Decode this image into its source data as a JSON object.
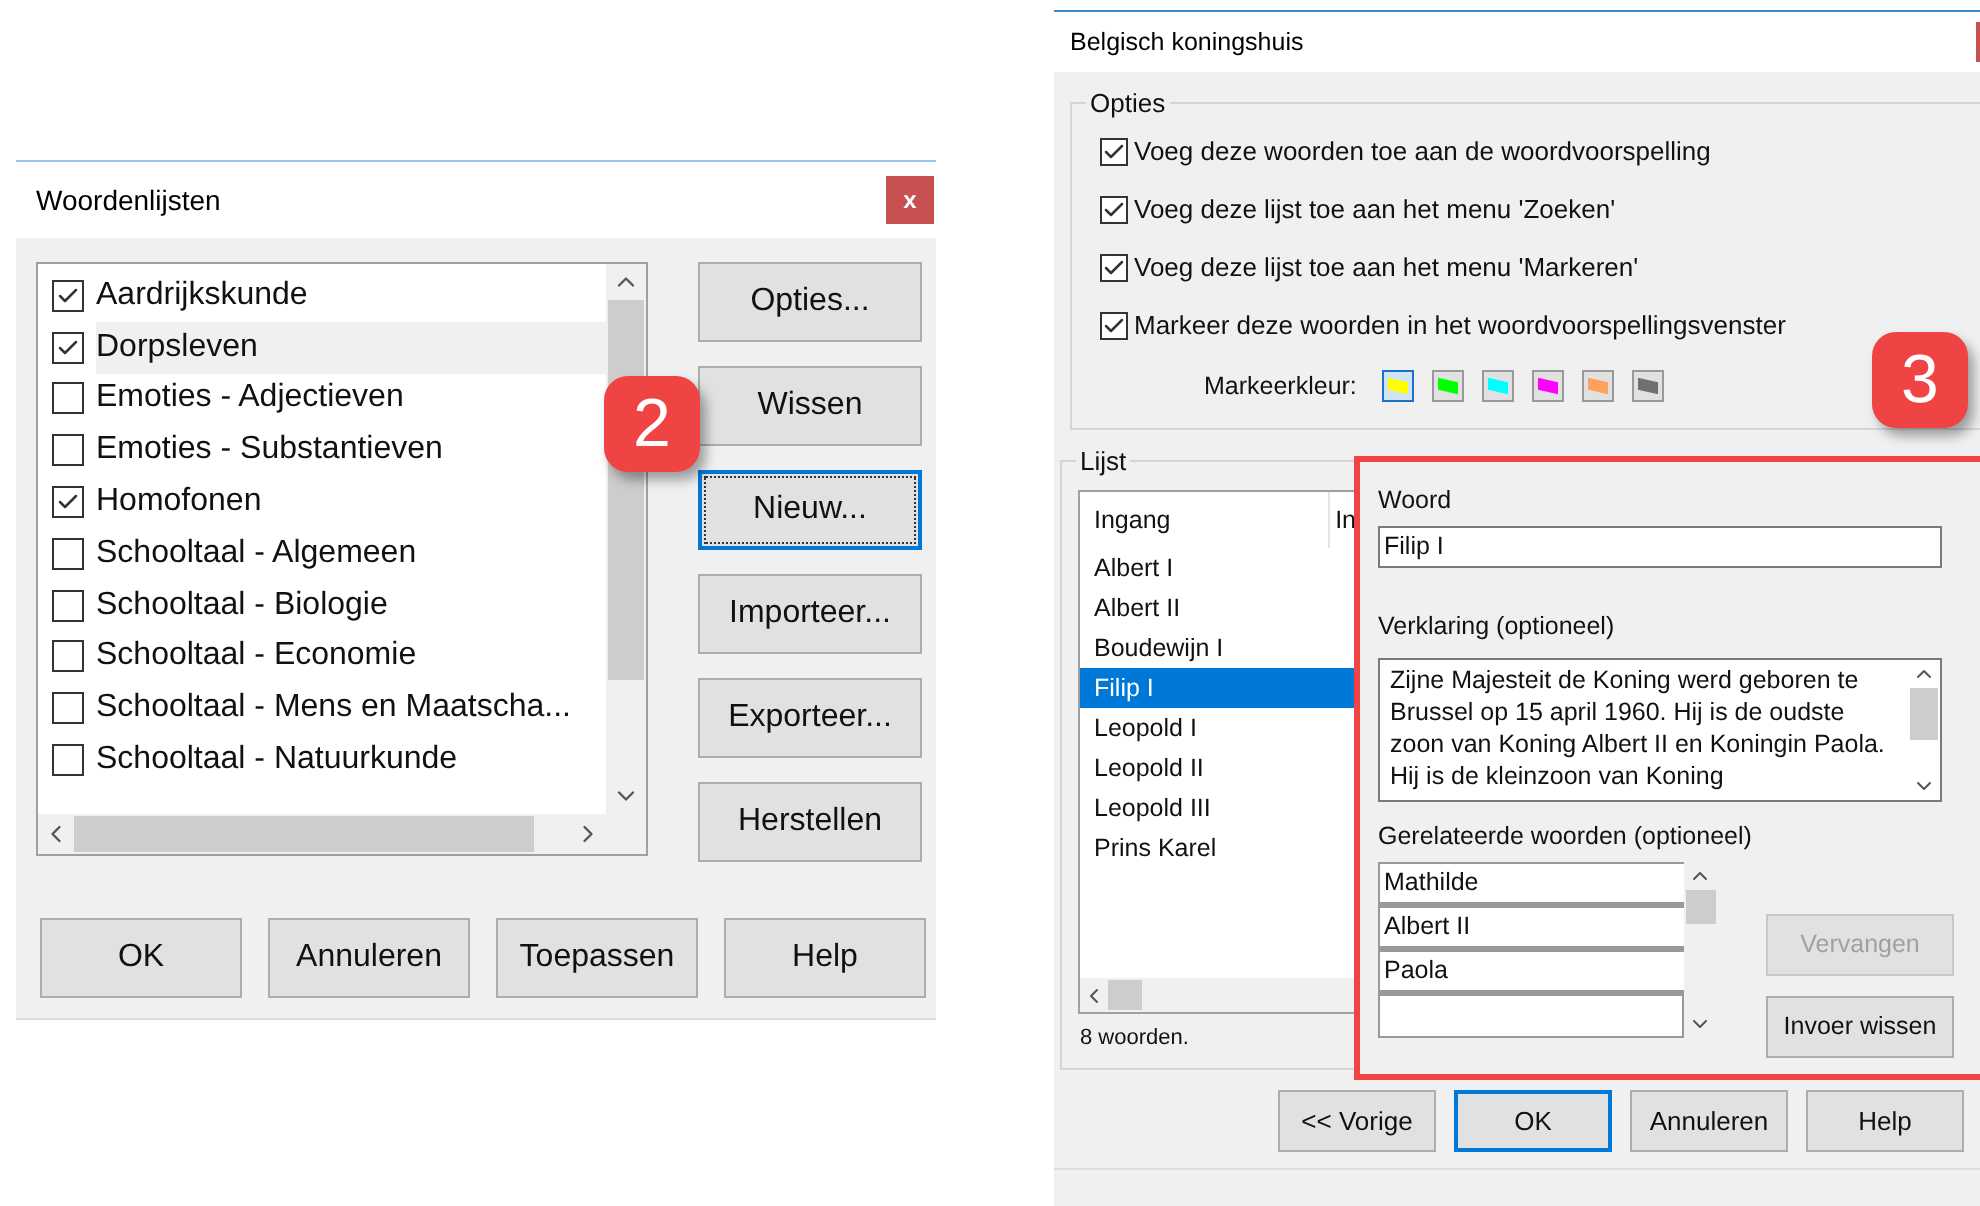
{
  "left_dialog": {
    "title": "Woordenlijsten",
    "close": "x",
    "lists": [
      {
        "label": "Aardrijkskunde",
        "checked": true,
        "selected": false
      },
      {
        "label": "Dorpsleven",
        "checked": true,
        "selected": true
      },
      {
        "label": "Emoties - Adjectieven",
        "checked": false,
        "selected": false
      },
      {
        "label": "Emoties - Substantieven",
        "checked": false,
        "selected": false
      },
      {
        "label": "Homofonen",
        "checked": true,
        "selected": false
      },
      {
        "label": "Schooltaal - Algemeen",
        "checked": false,
        "selected": false
      },
      {
        "label": "Schooltaal - Biologie",
        "checked": false,
        "selected": false
      },
      {
        "label": "Schooltaal - Economie",
        "checked": false,
        "selected": false
      },
      {
        "label": "Schooltaal - Mens en Maatscha...",
        "checked": false,
        "selected": false
      },
      {
        "label": "Schooltaal - Natuurkunde",
        "checked": false,
        "selected": false
      }
    ],
    "side_buttons": [
      {
        "label": "Opties...",
        "focused": false
      },
      {
        "label": "Wissen",
        "focused": false
      },
      {
        "label": "Nieuw...",
        "focused": true
      },
      {
        "label": "Importeer...",
        "focused": false
      },
      {
        "label": "Exporteer...",
        "focused": false
      },
      {
        "label": "Herstellen",
        "focused": false
      }
    ],
    "buttons": [
      "OK",
      "Annuleren",
      "Toepassen",
      "Help"
    ],
    "badge": "2"
  },
  "right_dialog": {
    "title": "Belgisch koningshuis",
    "options_group": {
      "title": "Opties",
      "options": [
        {
          "label": "Voeg deze woorden toe aan de woordvoorspelling",
          "checked": true
        },
        {
          "label": "Voeg deze lijst toe aan het menu 'Zoeken'",
          "checked": true
        },
        {
          "label": "Voeg deze lijst toe aan het menu 'Markeren'",
          "checked": true
        },
        {
          "label": "Markeer deze woorden in het woordvoorspellingsvenster",
          "checked": true
        }
      ],
      "color_label": "Markeerkleur:",
      "colors": [
        {
          "color": "#ffff00",
          "selected": true
        },
        {
          "color": "#00ff00",
          "selected": false
        },
        {
          "color": "#00ffff",
          "selected": false
        },
        {
          "color": "#ff00ff",
          "selected": false
        },
        {
          "color": "#ffa060",
          "selected": false
        },
        {
          "color": "#707070",
          "selected": false
        }
      ]
    },
    "list_group": {
      "title": "Lijst",
      "columns": [
        "Ingang",
        "In"
      ],
      "entries": [
        {
          "label": "Albert I",
          "selected": false
        },
        {
          "label": "Albert II",
          "selected": false
        },
        {
          "label": "Boudewijn I",
          "selected": false
        },
        {
          "label": "Filip I",
          "selected": true
        },
        {
          "label": "Leopold I",
          "selected": false
        },
        {
          "label": "Leopold II",
          "selected": false
        },
        {
          "label": "Leopold III",
          "selected": false
        },
        {
          "label": "Prins Karel",
          "selected": false
        }
      ],
      "count": "8 woorden."
    },
    "editor": {
      "word_label": "Woord",
      "word": "Filip I",
      "explanation_label": "Verklaring (optioneel)",
      "explanation": "Zijne Majesteit de Koning werd geboren te Brussel op 15 april 1960. Hij is de oudste zoon van Koning Albert II en Koningin Paola. Hij is de kleinzoon van Koning",
      "related_label": "Gerelateerde woorden (optioneel)",
      "related": [
        "Mathilde",
        "Albert II",
        "Paola"
      ],
      "buttons": [
        {
          "label": "Vervangen",
          "disabled": true
        },
        {
          "label": "Invoer wissen",
          "disabled": false
        }
      ]
    },
    "buttons": [
      {
        "label": "<< Vorige",
        "default": false
      },
      {
        "label": "OK",
        "default": true
      },
      {
        "label": "Annuleren",
        "default": false
      },
      {
        "label": "Help",
        "default": false
      }
    ],
    "badge": "3"
  }
}
